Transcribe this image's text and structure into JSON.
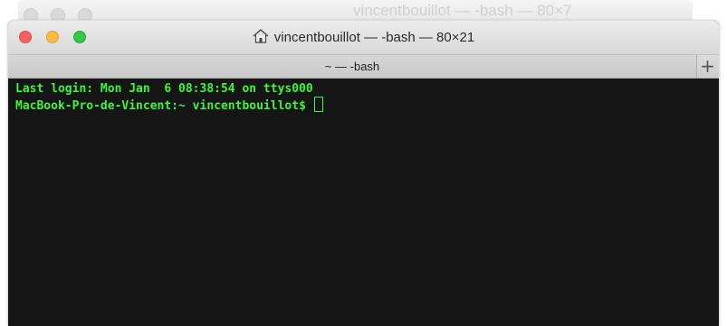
{
  "background_window": {
    "title": "vincentbouillot — -bash — 80×7"
  },
  "window": {
    "title": "vincentbouillot — -bash — 80×21",
    "title_icon": "home-icon"
  },
  "tabs": [
    {
      "label": "~ — -bash",
      "active": true
    }
  ],
  "new_tab_label": "+",
  "terminal": {
    "line1": "Last login: Mon Jan  6 08:38:54 on ttys000",
    "prompt": "MacBook-Pro-de-Vincent:~ vincentbouillot$ "
  },
  "colors": {
    "terminal_bg": "#151515",
    "terminal_text": "#3cf53c",
    "close": "#fc615d",
    "minimize": "#fdbc40",
    "maximize": "#34c84a"
  }
}
